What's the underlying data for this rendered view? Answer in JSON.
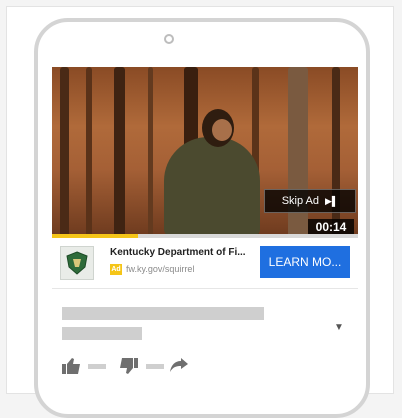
{
  "video": {
    "skip_label": "Skip Ad",
    "timer": "00:14",
    "progress": 0.28
  },
  "ad": {
    "advertiser": "Kentucky Department of Fi...",
    "badge": "Ad",
    "url": "fw.ky.gov/squirrel",
    "cta_label": "LEARN MO..."
  },
  "colors": {
    "cta": "#1f6fe0",
    "progress": "#f5c518"
  },
  "icons": [
    "skip-icon",
    "chevron-down-icon",
    "thumbs-up-icon",
    "thumbs-down-icon",
    "share-icon"
  ]
}
